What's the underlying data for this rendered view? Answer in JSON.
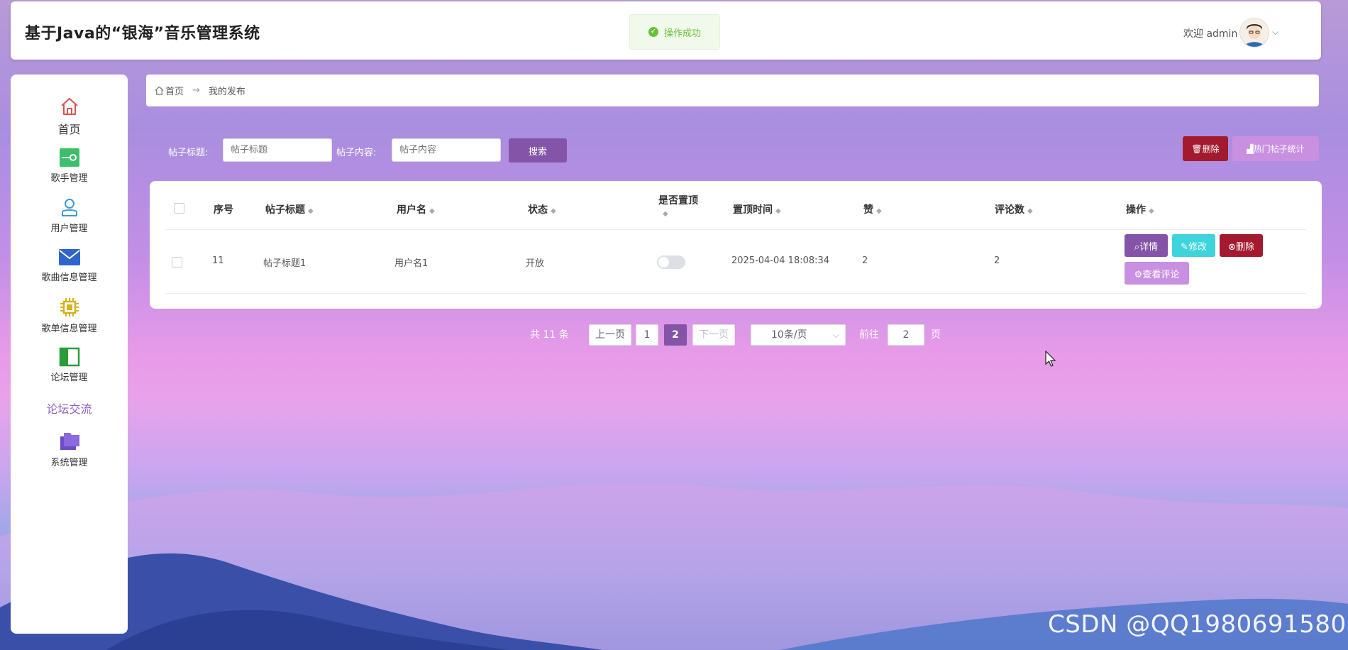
{
  "header": {
    "title": "基于Java的“银海”音乐管理系统",
    "toast": "操作成功",
    "welcome": "欢迎 admin"
  },
  "sidebar": {
    "items": [
      {
        "label": "首页",
        "icon": "home-icon"
      },
      {
        "label": "歌手管理",
        "icon": "toggle-icon"
      },
      {
        "label": "用户管理",
        "icon": "user-icon"
      },
      {
        "label": "歌曲信息管理",
        "icon": "envelope-icon"
      },
      {
        "label": "歌单信息管理",
        "icon": "chip-icon"
      },
      {
        "label": "论坛管理",
        "icon": "panel-icon"
      },
      {
        "label": "论坛交流",
        "icon": ""
      },
      {
        "label": "系统管理",
        "icon": "folder-icon"
      }
    ]
  },
  "breadcrumb": {
    "home": "首页",
    "separator": "→",
    "current": "我的发布"
  },
  "search": {
    "title_label": "帖子标题:",
    "title_placeholder": "帖子标题",
    "content_label": "帖子内容:",
    "content_placeholder": "帖子内容",
    "search_button": "搜索",
    "delete_button": "删除",
    "stats_button": "热门帖子统计"
  },
  "table": {
    "columns": [
      "序号",
      "帖子标题",
      "用户名",
      "状态",
      "是否置顶",
      "置顶时间",
      "赞",
      "评论数",
      "操作"
    ],
    "rows": [
      {
        "index": "11",
        "title": "帖子标题1",
        "username": "用户名1",
        "status": "开放",
        "top_time": "2025-04-04 18:08:34",
        "likes": "2",
        "comments": "2"
      }
    ],
    "actions": {
      "detail": "详情",
      "edit": "修改",
      "delete": "删除",
      "view_comments": "查看评论"
    }
  },
  "pagination": {
    "total": "共 11 条",
    "prev": "上一页",
    "pages": [
      "1",
      "2"
    ],
    "current": "2",
    "next": "下一页",
    "page_size": "10条/页",
    "goto_label": "前往",
    "goto_value": "2",
    "goto_suffix": "页"
  },
  "watermark": "CSDN @QQ1980691580",
  "colors": {
    "primary": "#8354a8",
    "danger": "#a31a2e",
    "cyan": "#3fd3db",
    "light_purple": "#c990e2"
  }
}
